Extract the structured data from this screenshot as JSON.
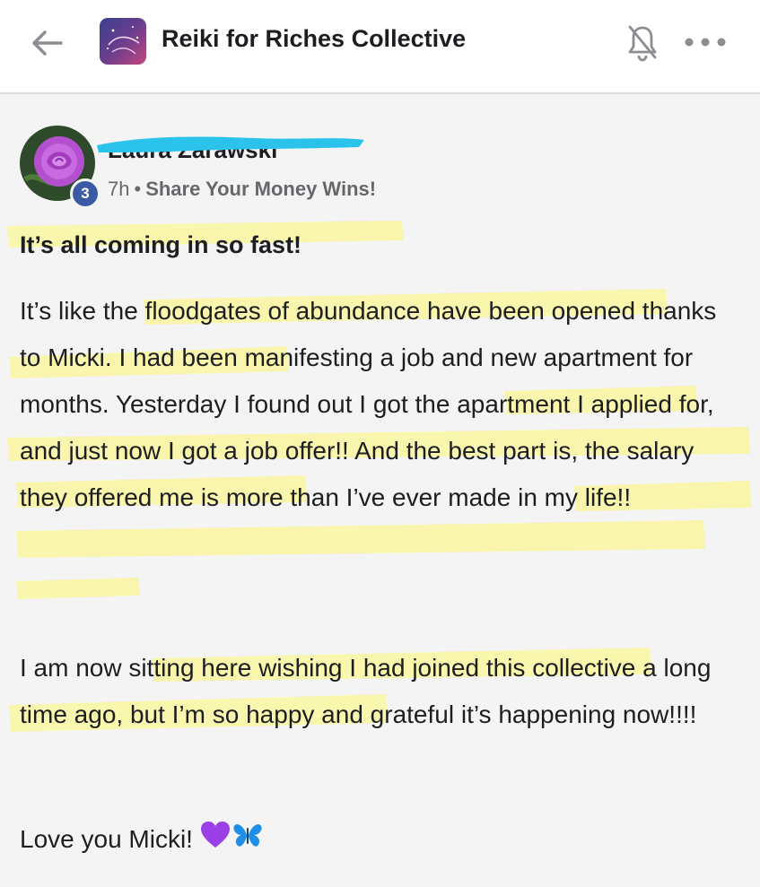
{
  "header": {
    "group_name": "Reiki for Riches Collective",
    "back_icon": "arrow-left-icon",
    "notification_icon": "bell-off-icon",
    "more_icon": "more-horizontal-icon"
  },
  "post": {
    "author_name": "Laura Zarawski",
    "badge_count": "3",
    "time": "7h",
    "separator": "•",
    "topic": "Share Your Money Wins!",
    "title": "It’s all coming in so fast!",
    "paragraphs": [
      "It’s like the floodgates of abundance have been opened thanks to Micki. I had been manifesting a job and new apartment for months. Yesterday I found out I got the apartment I applied for, and just now I got a job offer!! And the best part is, the salary they offered me is more than I’ve ever made in my life!!",
      "I am now sitting here wishing I had joined this collective a long time ago, but I’m so happy and grateful it’s happening now!!!!",
      "Love you Micki!"
    ],
    "emojis": [
      "purple-heart-icon",
      "butterfly-icon"
    ]
  },
  "colors": {
    "highlight": "#faf6a6",
    "redaction": "#2bc3ec",
    "badge": "#3b5ba5",
    "meta_text": "#65676b",
    "purple_heart": "#9b3fe6",
    "butterfly": "#1e8ee6"
  }
}
